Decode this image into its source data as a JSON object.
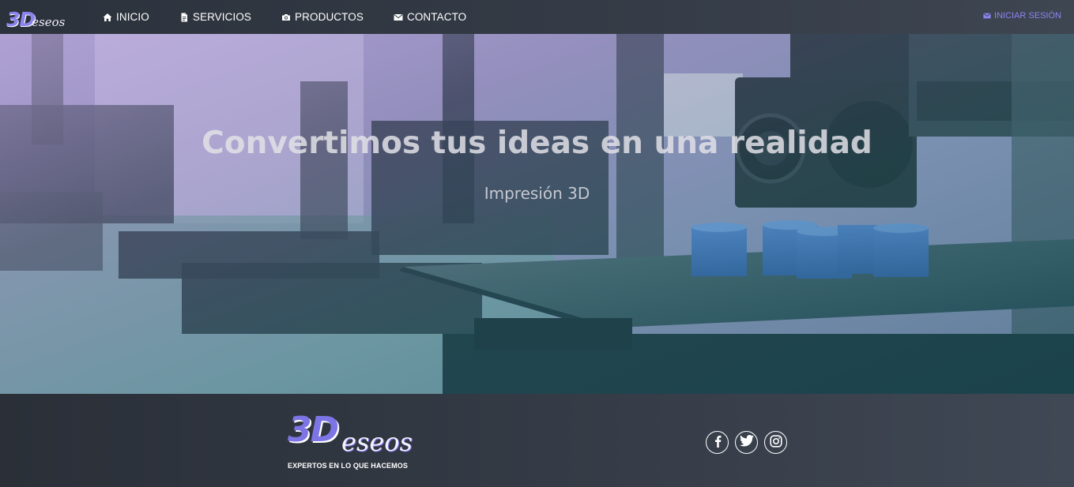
{
  "brand": {
    "logo_big": "3D",
    "logo_small": "eseos"
  },
  "nav": {
    "items": [
      {
        "label": "INICIO",
        "icon": "home-icon"
      },
      {
        "label": "SERVICIOS",
        "icon": "document-icon"
      },
      {
        "label": "PRODUCTOS",
        "icon": "camera-icon"
      },
      {
        "label": "CONTACTO",
        "icon": "envelope-icon"
      }
    ],
    "login": {
      "label": "INICIAR SESIÓN",
      "icon": "envelope-icon"
    }
  },
  "hero": {
    "title": "Convertimos tus ideas en una realidad",
    "subtitle": "Impresión 3D"
  },
  "footer": {
    "logo_big": "3D",
    "logo_small": "eseos",
    "tagline": "EXPERTOS EN LO QUE HACEMOS",
    "social": [
      "facebook-icon",
      "twitter-icon",
      "instagram-icon"
    ]
  },
  "colors": {
    "accent": "#8b84ee",
    "navbar": "#353c47",
    "footer": "#363d48",
    "white": "#ffffff"
  }
}
